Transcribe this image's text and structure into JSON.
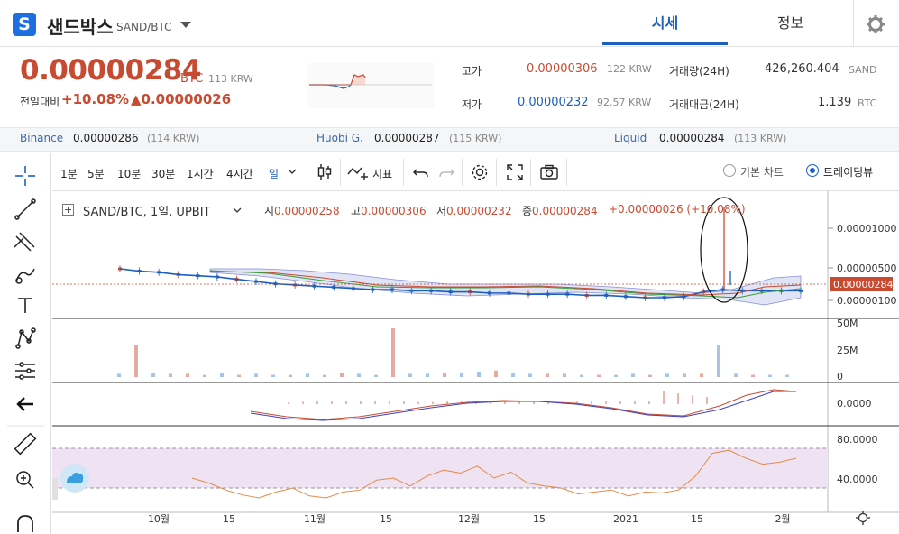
{
  "coin": {
    "logo_letter": "S",
    "name": "샌드박스",
    "pair": "SAND/BTC"
  },
  "tabs": {
    "quote": "시세",
    "info": "정보"
  },
  "price": {
    "value": "0.00000284",
    "unit": "BTC",
    "krw": "113",
    "krw_unit": "KRW",
    "change_label": "전일대비",
    "change_pct": "+10.08%",
    "change_val": "▲0.00000026"
  },
  "stats": {
    "high_label": "고가",
    "high_value": "0.00000306",
    "high_krw": "122",
    "high_krw_unit": "KRW",
    "low_label": "저가",
    "low_value": "0.00000232",
    "low_krw": "92.57",
    "low_krw_unit": "KRW",
    "vol_label": "거래량(24H)",
    "vol_value": "426,260.404",
    "vol_unit": "SAND",
    "amt_label": "거래대금(24H)",
    "amt_value": "1.139",
    "amt_unit": "BTC"
  },
  "exchanges": [
    {
      "name": "Binance",
      "value": "0.00000286",
      "krw": "(114 KRW)"
    },
    {
      "name": "Huobi G.",
      "value": "0.00000287",
      "krw": "(115 KRW)"
    },
    {
      "name": "Liquid",
      "value": "0.00000284",
      "krw": "(113 KRW)"
    }
  ],
  "toolbar": {
    "intervals": [
      "1분",
      "5분",
      "10분",
      "30분",
      "1시간",
      "4시간",
      "일"
    ],
    "indicator_label": "지표",
    "basic_chart": "기본 차트",
    "trading_view": "트레이딩뷰"
  },
  "legend": {
    "title": "SAND/BTC, 1일, UPBIT",
    "open_label": "시",
    "open": "0.00000258",
    "high_label": "고",
    "high": "0.00000306",
    "low_label": "저",
    "low": "0.00000232",
    "close_label": "종",
    "close": "0.00000284",
    "change": "+0.00000026 (+10.08%)"
  },
  "colors": {
    "up": "#c84a31",
    "down": "#1d5fbf",
    "accent": "#1d6fe0"
  },
  "chart_data": {
    "type": "line",
    "x_ticks": [
      "10월",
      "15",
      "11월",
      "15",
      "12월",
      "15",
      "2021",
      "15",
      "2월"
    ],
    "price_axis": [
      "0.00001000",
      "0.00000500",
      "0.00000100"
    ],
    "last_price_label": "0.00000284",
    "volume_axis": [
      "50M",
      "25M",
      "0"
    ],
    "macd_axis": [
      "0.0000"
    ],
    "rsi_axis": [
      "80.0000",
      "40.0000"
    ],
    "price_series": {
      "name": "price",
      "values": [
        4.7e-06,
        4.5e-06,
        4.4e-06,
        4.2e-06,
        4.1e-06,
        4e-06,
        3.8e-06,
        3.6e-06,
        3.4e-06,
        3.3e-06,
        3.2e-06,
        3.1e-06,
        3e-06,
        2.9e-06,
        2.9e-06,
        2.8e-06,
        2.8e-06,
        2.7e-06,
        2.7e-06,
        2.6e-06,
        2.6e-06,
        2.5e-06,
        2.5e-06,
        2.5e-06,
        2.4e-06,
        2.4e-06,
        2.3e-06,
        2.2e-06,
        2.2e-06,
        2.3e-06,
        2.7e-06,
        2.9e-06,
        2.8e-06,
        2.8e-06,
        2.8e-06,
        2.8e-06
      ]
    },
    "volume_series": {
      "name": "volume",
      "values": [
        3,
        30,
        4,
        3,
        3,
        2,
        4,
        2,
        3,
        2,
        2,
        3,
        2,
        4,
        3,
        2,
        45,
        3,
        3,
        4,
        4,
        5,
        6,
        4,
        3,
        3,
        3,
        2,
        2,
        2,
        3,
        2,
        3,
        3,
        3,
        30,
        3,
        2,
        2,
        2
      ]
    },
    "rsi_series": {
      "name": "rsi",
      "values": [
        50,
        45,
        38,
        33,
        30,
        36,
        40,
        32,
        30,
        36,
        38,
        48,
        50,
        42,
        52,
        58,
        55,
        62,
        50,
        56,
        45,
        42,
        40,
        34,
        36,
        38,
        32,
        36,
        35,
        38,
        52,
        75,
        78,
        70,
        64,
        66,
        70
      ]
    }
  }
}
